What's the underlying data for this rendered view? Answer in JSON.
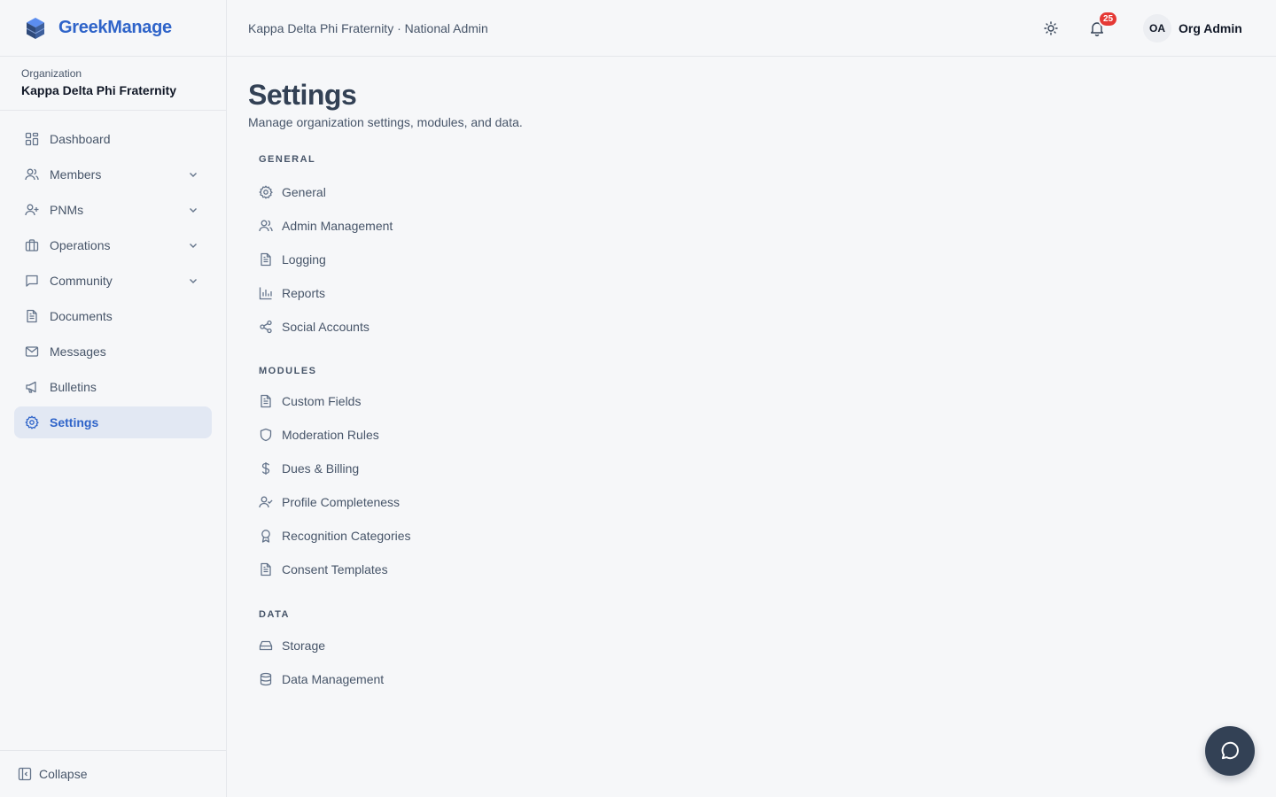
{
  "brand": {
    "name": "GreekManage"
  },
  "organization": {
    "label": "Organization",
    "name": "Kappa Delta Phi Fraternity"
  },
  "sidebar": {
    "items": [
      {
        "label": "Dashboard",
        "icon": "dashboard-icon"
      },
      {
        "label": "Members",
        "icon": "users-icon",
        "expandable": true
      },
      {
        "label": "PNMs",
        "icon": "user-plus-icon",
        "expandable": true
      },
      {
        "label": "Operations",
        "icon": "briefcase-icon",
        "expandable": true
      },
      {
        "label": "Community",
        "icon": "chat-icon",
        "expandable": true
      },
      {
        "label": "Documents",
        "icon": "document-icon"
      },
      {
        "label": "Messages",
        "icon": "mail-icon"
      },
      {
        "label": "Bulletins",
        "icon": "megaphone-icon"
      },
      {
        "label": "Settings",
        "icon": "gear-icon",
        "active": true
      }
    ],
    "collapse_label": "Collapse"
  },
  "header": {
    "title": "Kappa Delta Phi Fraternity · National Admin",
    "notification_count": "25",
    "user_initials": "OA",
    "user_name": "Org Admin"
  },
  "main": {
    "title": "Settings",
    "subtitle": "Manage organization settings, modules, and data.",
    "sections": [
      {
        "title": "General",
        "items": [
          {
            "label": "General",
            "icon": "gear-icon"
          },
          {
            "label": "Admin Management",
            "icon": "users-icon"
          },
          {
            "label": "Logging",
            "icon": "document-icon"
          },
          {
            "label": "Reports",
            "icon": "bar-chart-icon"
          },
          {
            "label": "Social Accounts",
            "icon": "share-icon"
          }
        ]
      },
      {
        "title": "Modules",
        "items": [
          {
            "label": "Custom Fields",
            "icon": "document-icon"
          },
          {
            "label": "Moderation Rules",
            "icon": "shield-icon"
          },
          {
            "label": "Dues & Billing",
            "icon": "dollar-icon"
          },
          {
            "label": "Profile Completeness",
            "icon": "user-check-icon"
          },
          {
            "label": "Recognition Categories",
            "icon": "award-icon"
          },
          {
            "label": "Consent Templates",
            "icon": "document-icon"
          }
        ]
      },
      {
        "title": "Data",
        "items": [
          {
            "label": "Storage",
            "icon": "hard-drive-icon"
          },
          {
            "label": "Data Management",
            "icon": "database-icon"
          }
        ]
      }
    ]
  },
  "colors": {
    "accent": "#2f64c9",
    "badge": "#e53935",
    "fab": "#334155"
  }
}
